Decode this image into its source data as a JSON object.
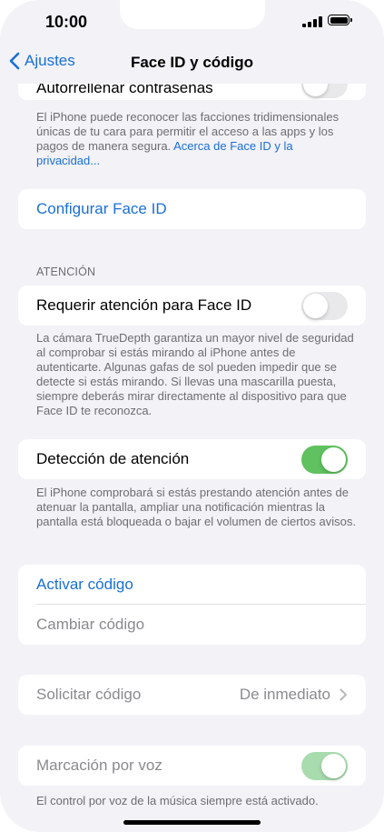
{
  "status_bar": {
    "time": "10:00"
  },
  "nav": {
    "back_label": "Ajustes",
    "title": "Face ID y código"
  },
  "autofill": {
    "label": "Autorrellenar contraseñas",
    "toggle_on": false,
    "footer": "El iPhone puede reconocer las facciones tridimensionales únicas de tu cara para permitir el acceso a las apps y los pagos de manera segura. ",
    "footer_link": "Acerca de Face ID y la privacidad..."
  },
  "setup": {
    "label": "Configurar Face ID"
  },
  "attention": {
    "header": "ATENCIÓN",
    "require_label": "Requerir atención para Face ID",
    "require_on": false,
    "require_footer": "La cámara TrueDepth garantiza un mayor nivel de seguridad al comprobar si estás mirando al iPhone antes de autenticarte. Algunas gafas de sol pueden impedir que se detecte si estás mirando. Si llevas una mascarilla puesta, siempre deberás mirar directamente al dispositivo para que Face ID te reconozca.",
    "detection_label": "Detección de atención",
    "detection_on": true,
    "detection_footer": "El iPhone comprobará si estás prestando atención antes de atenuar la pantalla, ampliar una notificación mientras la pantalla está bloqueada o bajar el volumen de ciertos avisos."
  },
  "passcode": {
    "activate_label": "Activar código",
    "change_label": "Cambiar código"
  },
  "require_passcode": {
    "label": "Solicitar código",
    "value": "De inmediato"
  },
  "voice_dial": {
    "label": "Marcación por voz",
    "toggle_on": true,
    "footer": "El control por voz de la música siempre está activado."
  },
  "colors": {
    "accent": "#1a6fd6",
    "toggle_on": "#5fc15f",
    "background": "#f2f2f7"
  },
  "icons": {
    "back": "chevron-left-icon",
    "disclosure": "chevron-right-icon"
  }
}
